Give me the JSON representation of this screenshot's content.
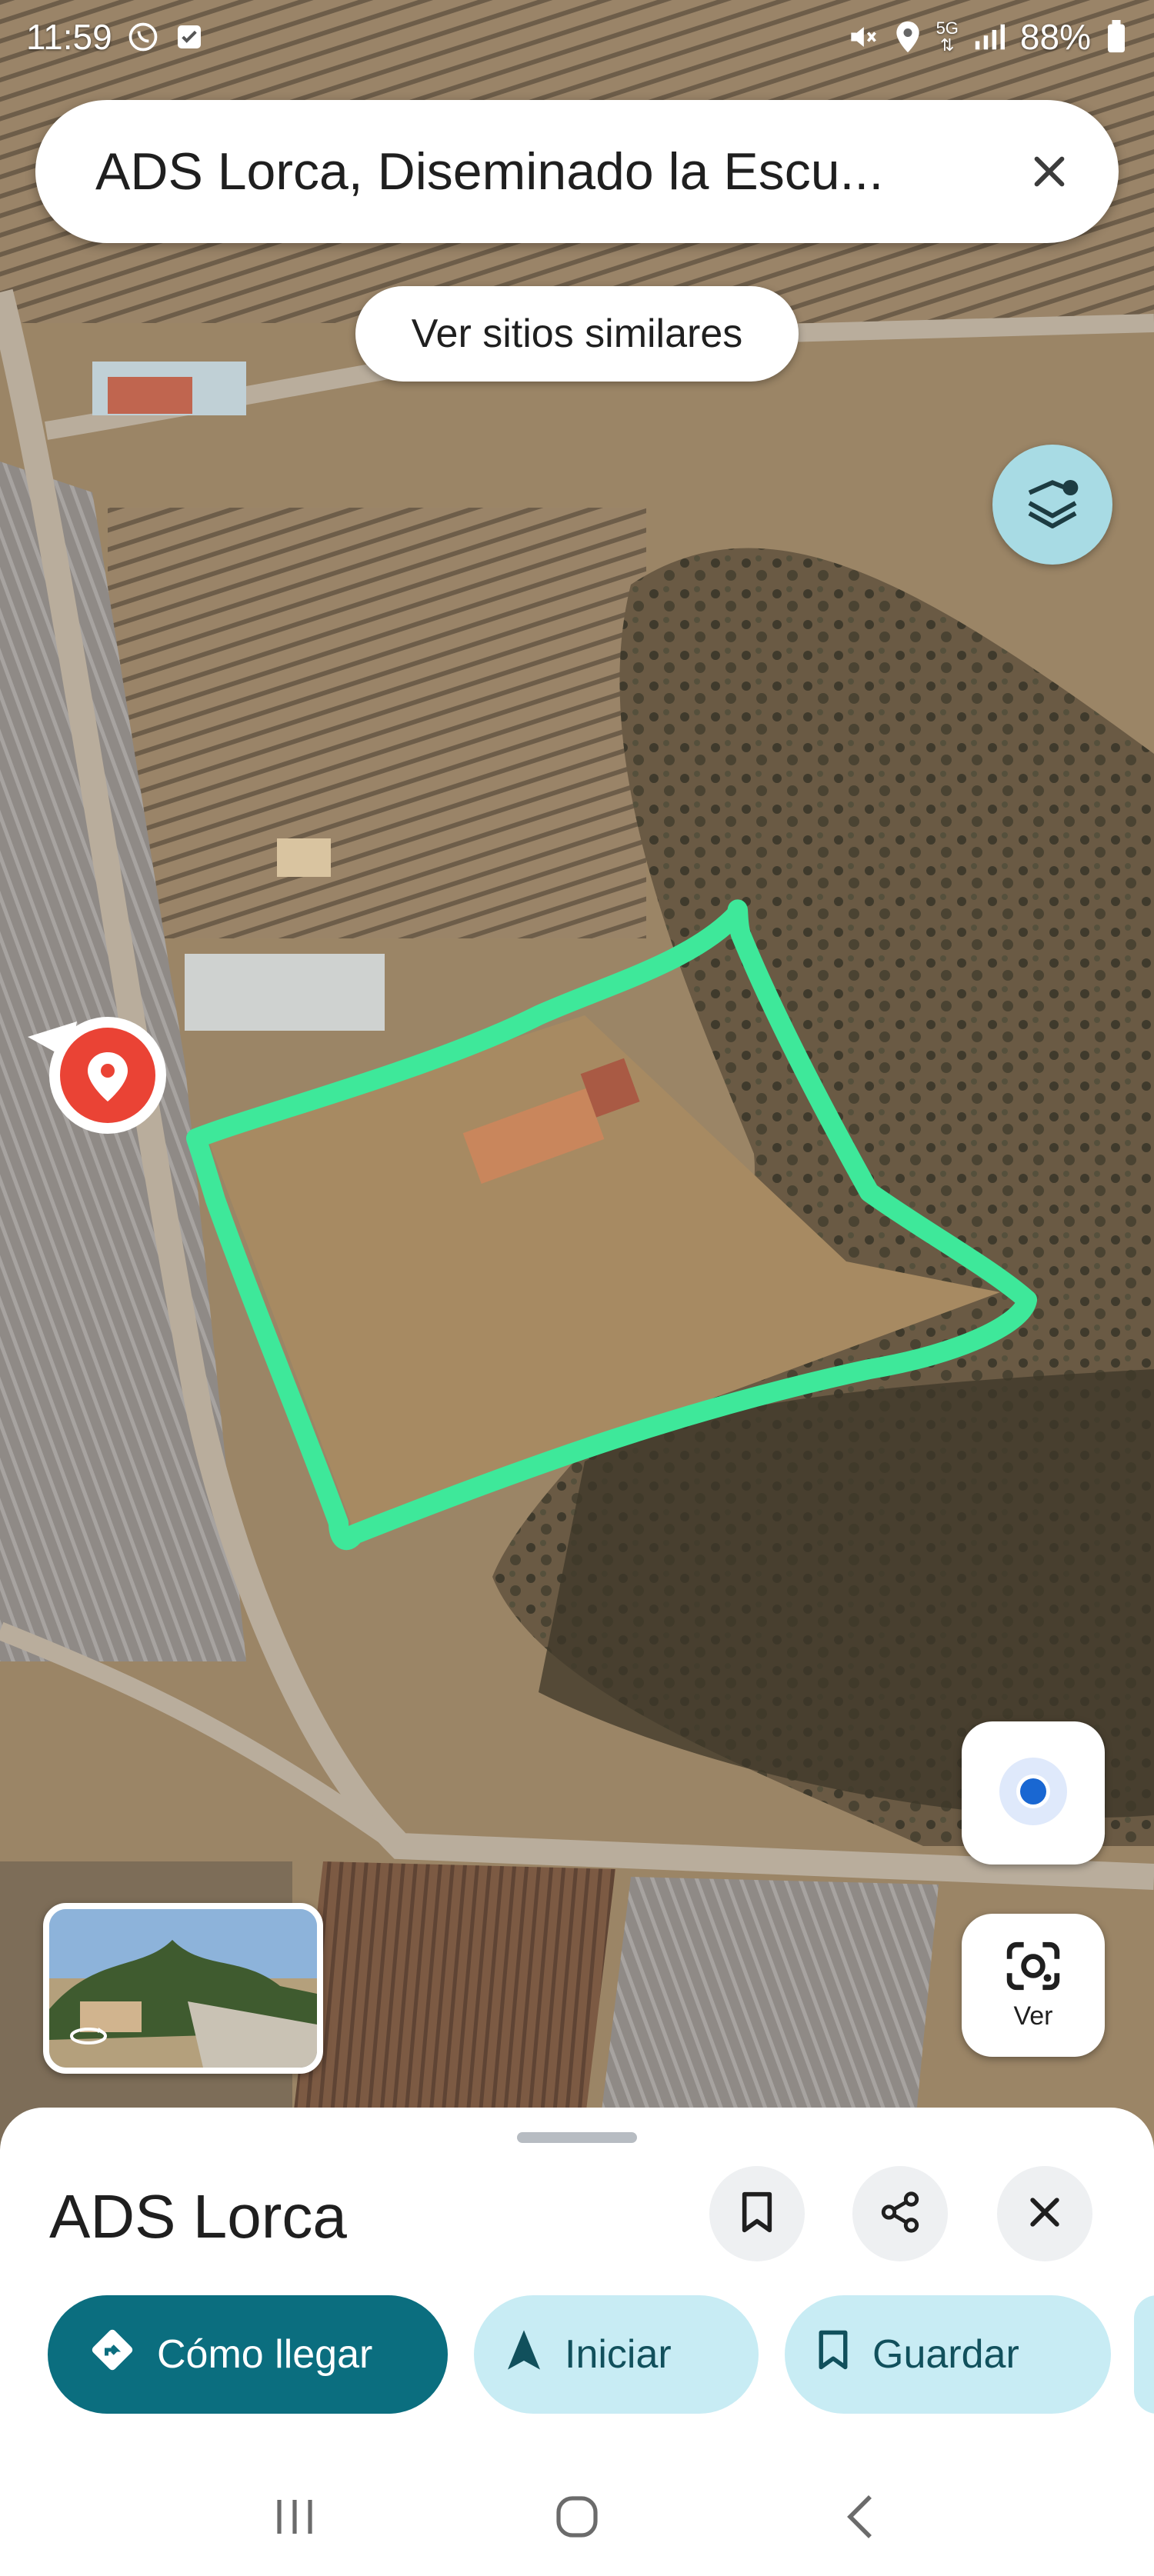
{
  "status_bar": {
    "time": "11:59",
    "network": "5G",
    "battery": "88%",
    "left_icons": [
      "whatsapp-icon",
      "check-notification-icon"
    ],
    "right_icons": [
      "mute-icon",
      "location-icon",
      "data-arrows-icon",
      "signal-icon",
      "battery-icon"
    ]
  },
  "search": {
    "text": "ADS Lorca, Diseminado la Escu...",
    "close_icon": "close-icon"
  },
  "similar_chip": {
    "label": "Ver sitios similares"
  },
  "map": {
    "layers_icon": "layers-icon",
    "location_icon": "my-location-icon",
    "lens": {
      "icon": "lens-icon",
      "label": "Ver"
    },
    "pin_icon": "place-pin-icon",
    "outline_color": "#3ee89a",
    "pin_color": "#ea4335"
  },
  "sheet": {
    "title": "ADS Lorca",
    "icons": [
      "bookmark-icon",
      "share-icon",
      "close-icon"
    ],
    "actions": [
      {
        "label": "Cómo llegar",
        "icon": "directions-icon",
        "style": "primary"
      },
      {
        "label": "Iniciar",
        "icon": "navigation-icon",
        "style": "tonal"
      },
      {
        "label": "Guardar",
        "icon": "bookmark-icon",
        "style": "tonal"
      }
    ]
  },
  "nav_bar": {
    "icons": [
      "recents-icon",
      "home-icon",
      "back-icon"
    ]
  },
  "colors": {
    "primary": "#0b6e7f",
    "tonal": "#c8ecf4",
    "accent_green": "#3ee89a"
  }
}
